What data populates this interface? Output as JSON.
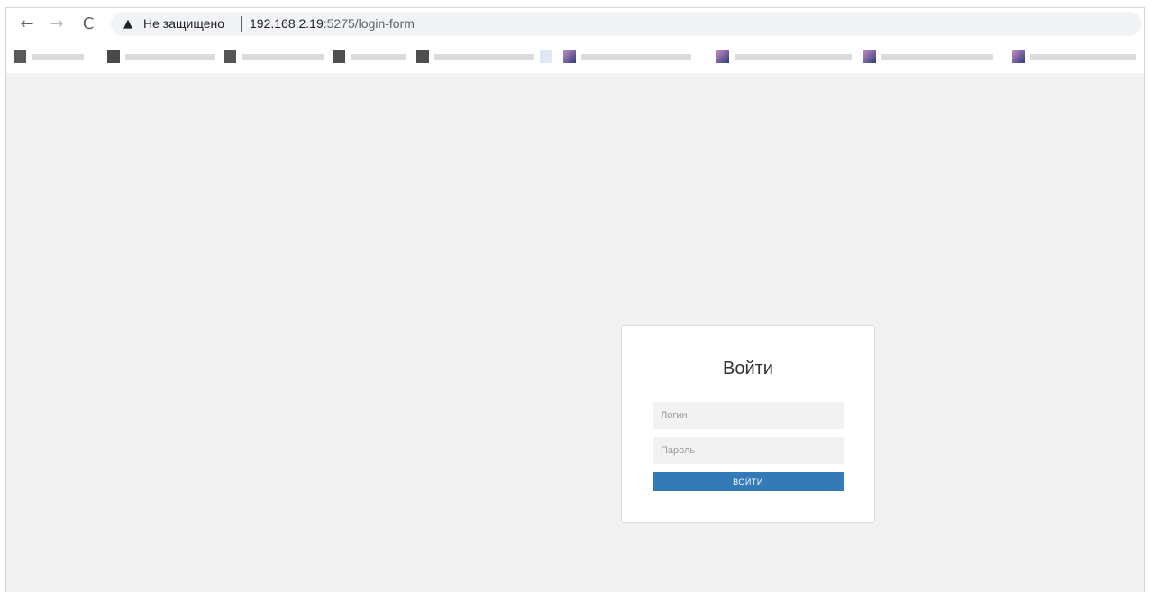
{
  "browser": {
    "back_icon": "arrow-left-icon",
    "forward_icon": "arrow-right-icon",
    "reload_icon": "reload-icon",
    "security_icon": "warning-triangle-icon",
    "security_label": "Не защищено",
    "url_host": "192.168.2.19",
    "url_rest": ":5275/login-form"
  },
  "login": {
    "title": "Войти",
    "login_placeholder": "Логин",
    "password_placeholder": "Пароль",
    "submit_label": "ВОЙТИ",
    "button_color": "#337ab7"
  }
}
